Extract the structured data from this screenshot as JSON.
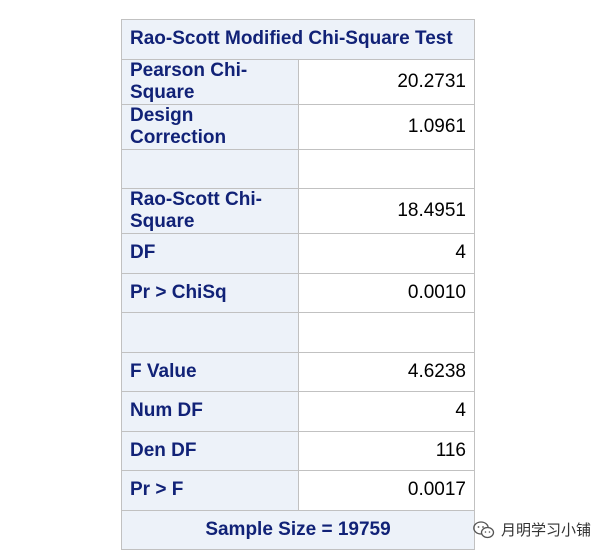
{
  "table": {
    "title": "Rao-Scott Modified Chi-Square Test",
    "rows": [
      {
        "label": "Pearson Chi-Square",
        "value": "20.2731"
      },
      {
        "label": "Design Correction",
        "value": "1.0961"
      },
      {
        "label": "",
        "value": ""
      },
      {
        "label": "Rao-Scott Chi-Square",
        "value": "18.4951"
      },
      {
        "label": "DF",
        "value": "4"
      },
      {
        "label": "Pr > ChiSq",
        "value": "0.0010"
      },
      {
        "label": "",
        "value": ""
      },
      {
        "label": "F Value",
        "value": "4.6238"
      },
      {
        "label": "Num DF",
        "value": "4"
      },
      {
        "label": "Den DF",
        "value": "116"
      },
      {
        "label": "Pr > F",
        "value": "0.0017"
      }
    ],
    "footer": "Sample Size = 19759"
  },
  "watermark": {
    "text": "月明学习小铺",
    "icon": "wechat-icon"
  }
}
